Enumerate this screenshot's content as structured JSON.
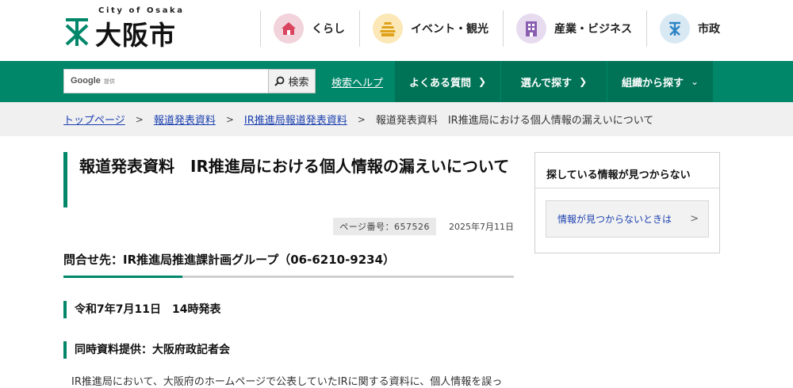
{
  "header": {
    "logo_sub": "City of Osaka",
    "logo_text": "大阪市",
    "nav": [
      {
        "label": "くらし",
        "icon": "house-icon",
        "color": "#f2d3dc"
      },
      {
        "label": "イベント・観光",
        "icon": "castle-icon",
        "color": "#fbe8b6"
      },
      {
        "label": "産業・ビジネス",
        "icon": "building-icon",
        "color": "#e7dcef"
      },
      {
        "label": "市政",
        "icon": "city-emblem-icon",
        "color": "#d8e9f4"
      }
    ]
  },
  "navbar": {
    "search_brand": "Google",
    "search_brand_note": "提供",
    "search_button": "検索",
    "search_help": "検索ヘルプ",
    "faq": "よくある質問",
    "choose": "選んで探す",
    "org": "組織から探す"
  },
  "breadcrumb": {
    "items": [
      "トップページ",
      "報道発表資料",
      "IR推進局報道発表資料"
    ],
    "current": "報道発表資料　IR推進局における個人情報の漏えいについて"
  },
  "main": {
    "title": "報道発表資料　IR推進局における個人情報の漏えいについて",
    "page_number": "ページ番号：657526",
    "date": "2025年7月11日",
    "contact": "問合せ先：IR推進局推進課計画グループ（06-6210-9234）",
    "announce": "令和7年7月11日　14時発表",
    "provided": "同時資料提供：大阪府政記者会",
    "body": "IR推進局において、大阪府のホームページで公表していたIRに関する資料に、個人情報を誤っ"
  },
  "side": {
    "heading": "探している情報が見つからない",
    "link": "情報が見つからないときは"
  },
  "colors": {
    "brand_green": "#00876a",
    "nav_dark_green": "#007356",
    "link_blue": "#1a3fb0"
  }
}
